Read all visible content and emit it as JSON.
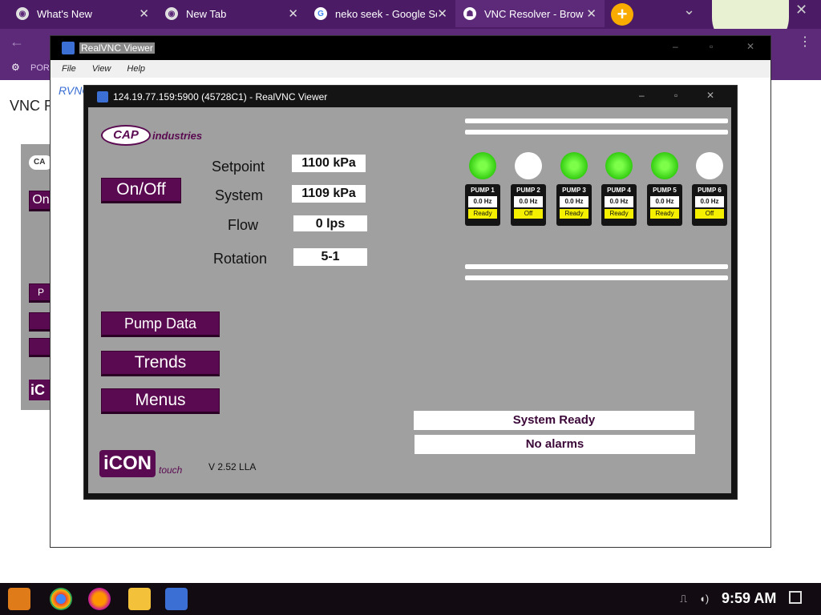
{
  "browser": {
    "tabs": [
      {
        "label": "What's New"
      },
      {
        "label": "New Tab"
      },
      {
        "label": "neko seek - Google Sé"
      },
      {
        "label": "VNC Resolver - Brows"
      }
    ],
    "bookmark_fragment": "POR",
    "page_heading_fragment": "VNC Re"
  },
  "outer_vnc": {
    "title": "RealVNC Viewer",
    "menu": [
      "File",
      "View",
      "Help"
    ],
    "logo_fragment": "RVNC"
  },
  "bg_left": {
    "btn_fragment": "On",
    "btn2_fragment": "P",
    "logo_fragment": "iC",
    "top_fragment": "CA"
  },
  "inner_vnc": {
    "title": "124.19.77.159:5900 (45728C1) - RealVNC Viewer"
  },
  "hmi": {
    "brand": "CAP",
    "brand_suffix": "industries",
    "onoff_label": "On/Off",
    "rows": [
      {
        "label": "Setpoint",
        "value": "1100 kPa"
      },
      {
        "label": "System",
        "value": "1109 kPa"
      },
      {
        "label": "Flow",
        "value": "0 lps"
      },
      {
        "label": "Rotation",
        "value": "5-1"
      }
    ],
    "buttons": {
      "pump_data": "Pump Data",
      "trends": "Trends",
      "menus": "Menus"
    },
    "pumps": [
      {
        "name": "PUMP 1",
        "hz": "0.0 Hz",
        "status": "Ready",
        "running": true
      },
      {
        "name": "PUMP 2",
        "hz": "0.0 Hz",
        "status": "Off",
        "running": false
      },
      {
        "name": "PUMP 3",
        "hz": "0.0 Hz",
        "status": "Ready",
        "running": true
      },
      {
        "name": "PUMP 4",
        "hz": "0.0 Hz",
        "status": "Ready",
        "running": true
      },
      {
        "name": "PUMP 5",
        "hz": "0.0 Hz",
        "status": "Ready",
        "running": true
      },
      {
        "name": "PUMP 6",
        "hz": "0.0 Hz",
        "status": "Off",
        "running": false
      }
    ],
    "status_line1": "System Ready",
    "status_line2": "No alarms",
    "icon_logo": "iCON",
    "icon_touch": "touch",
    "version": "V 2.52 LLA"
  },
  "taskbar": {
    "time": "9:59 AM"
  },
  "colors": {
    "brand_purple": "#5a0a50",
    "browser_bg": "#4b1b66",
    "led_on": "#33cc11",
    "led_off": "#ffffff",
    "status_yellow": "#f5f000"
  }
}
